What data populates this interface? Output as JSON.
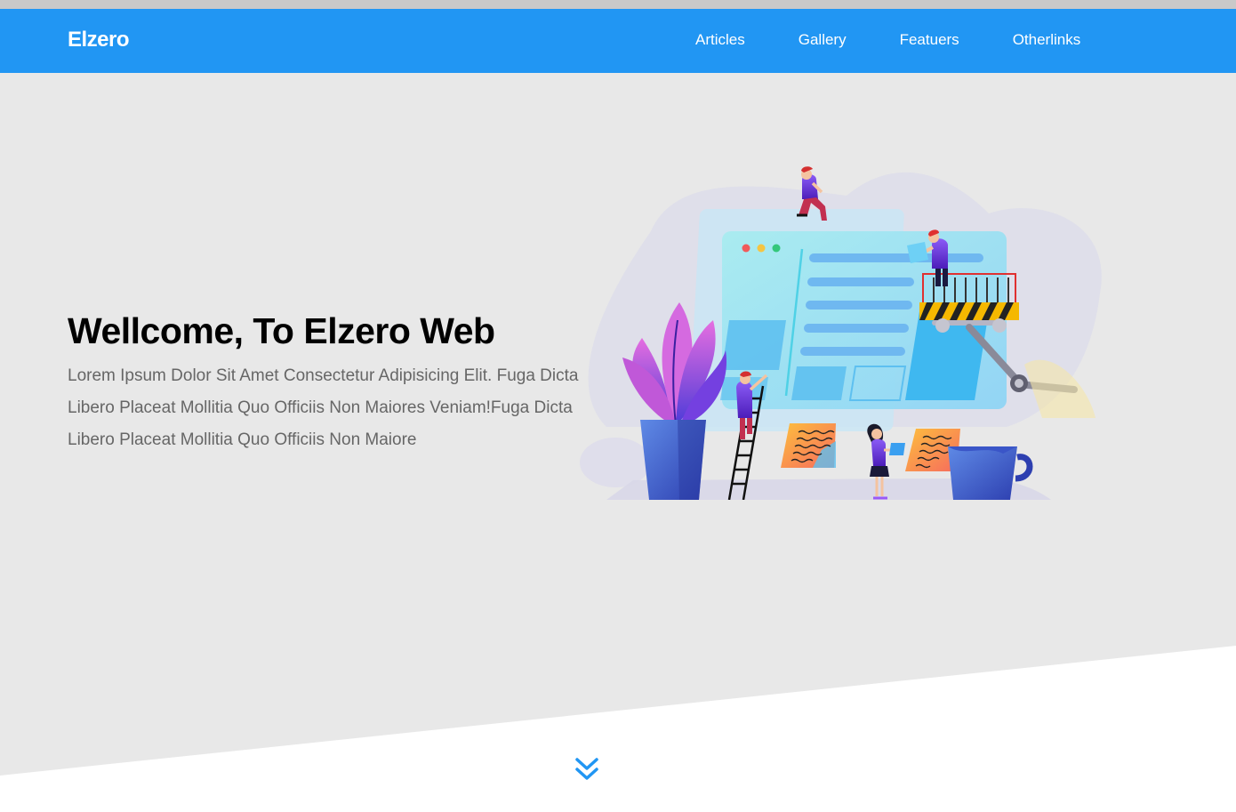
{
  "header": {
    "logo": "Elzero",
    "nav": [
      {
        "label": "Articles"
      },
      {
        "label": "Gallery"
      },
      {
        "label": "Featuers"
      },
      {
        "label": "Otherlinks"
      }
    ]
  },
  "landing": {
    "title": "Wellcome, To Elzero Web",
    "description": "Lorem Ipsum Dolor Sit Amet Consectetur Adipisicing Elit. Fuga Dicta Libero Placeat Mollitia Quo Officiis Non Maiores Veniam!Fuga Dicta Libero Placeat Mollitia Quo Officiis Non Maiore",
    "illustration": "website-building-illustration",
    "scroll_icon": "double-chevron-down-icon"
  },
  "colors": {
    "brand": "#2196f3",
    "landing_bg": "#e8e8e8",
    "text_muted": "#666666"
  }
}
